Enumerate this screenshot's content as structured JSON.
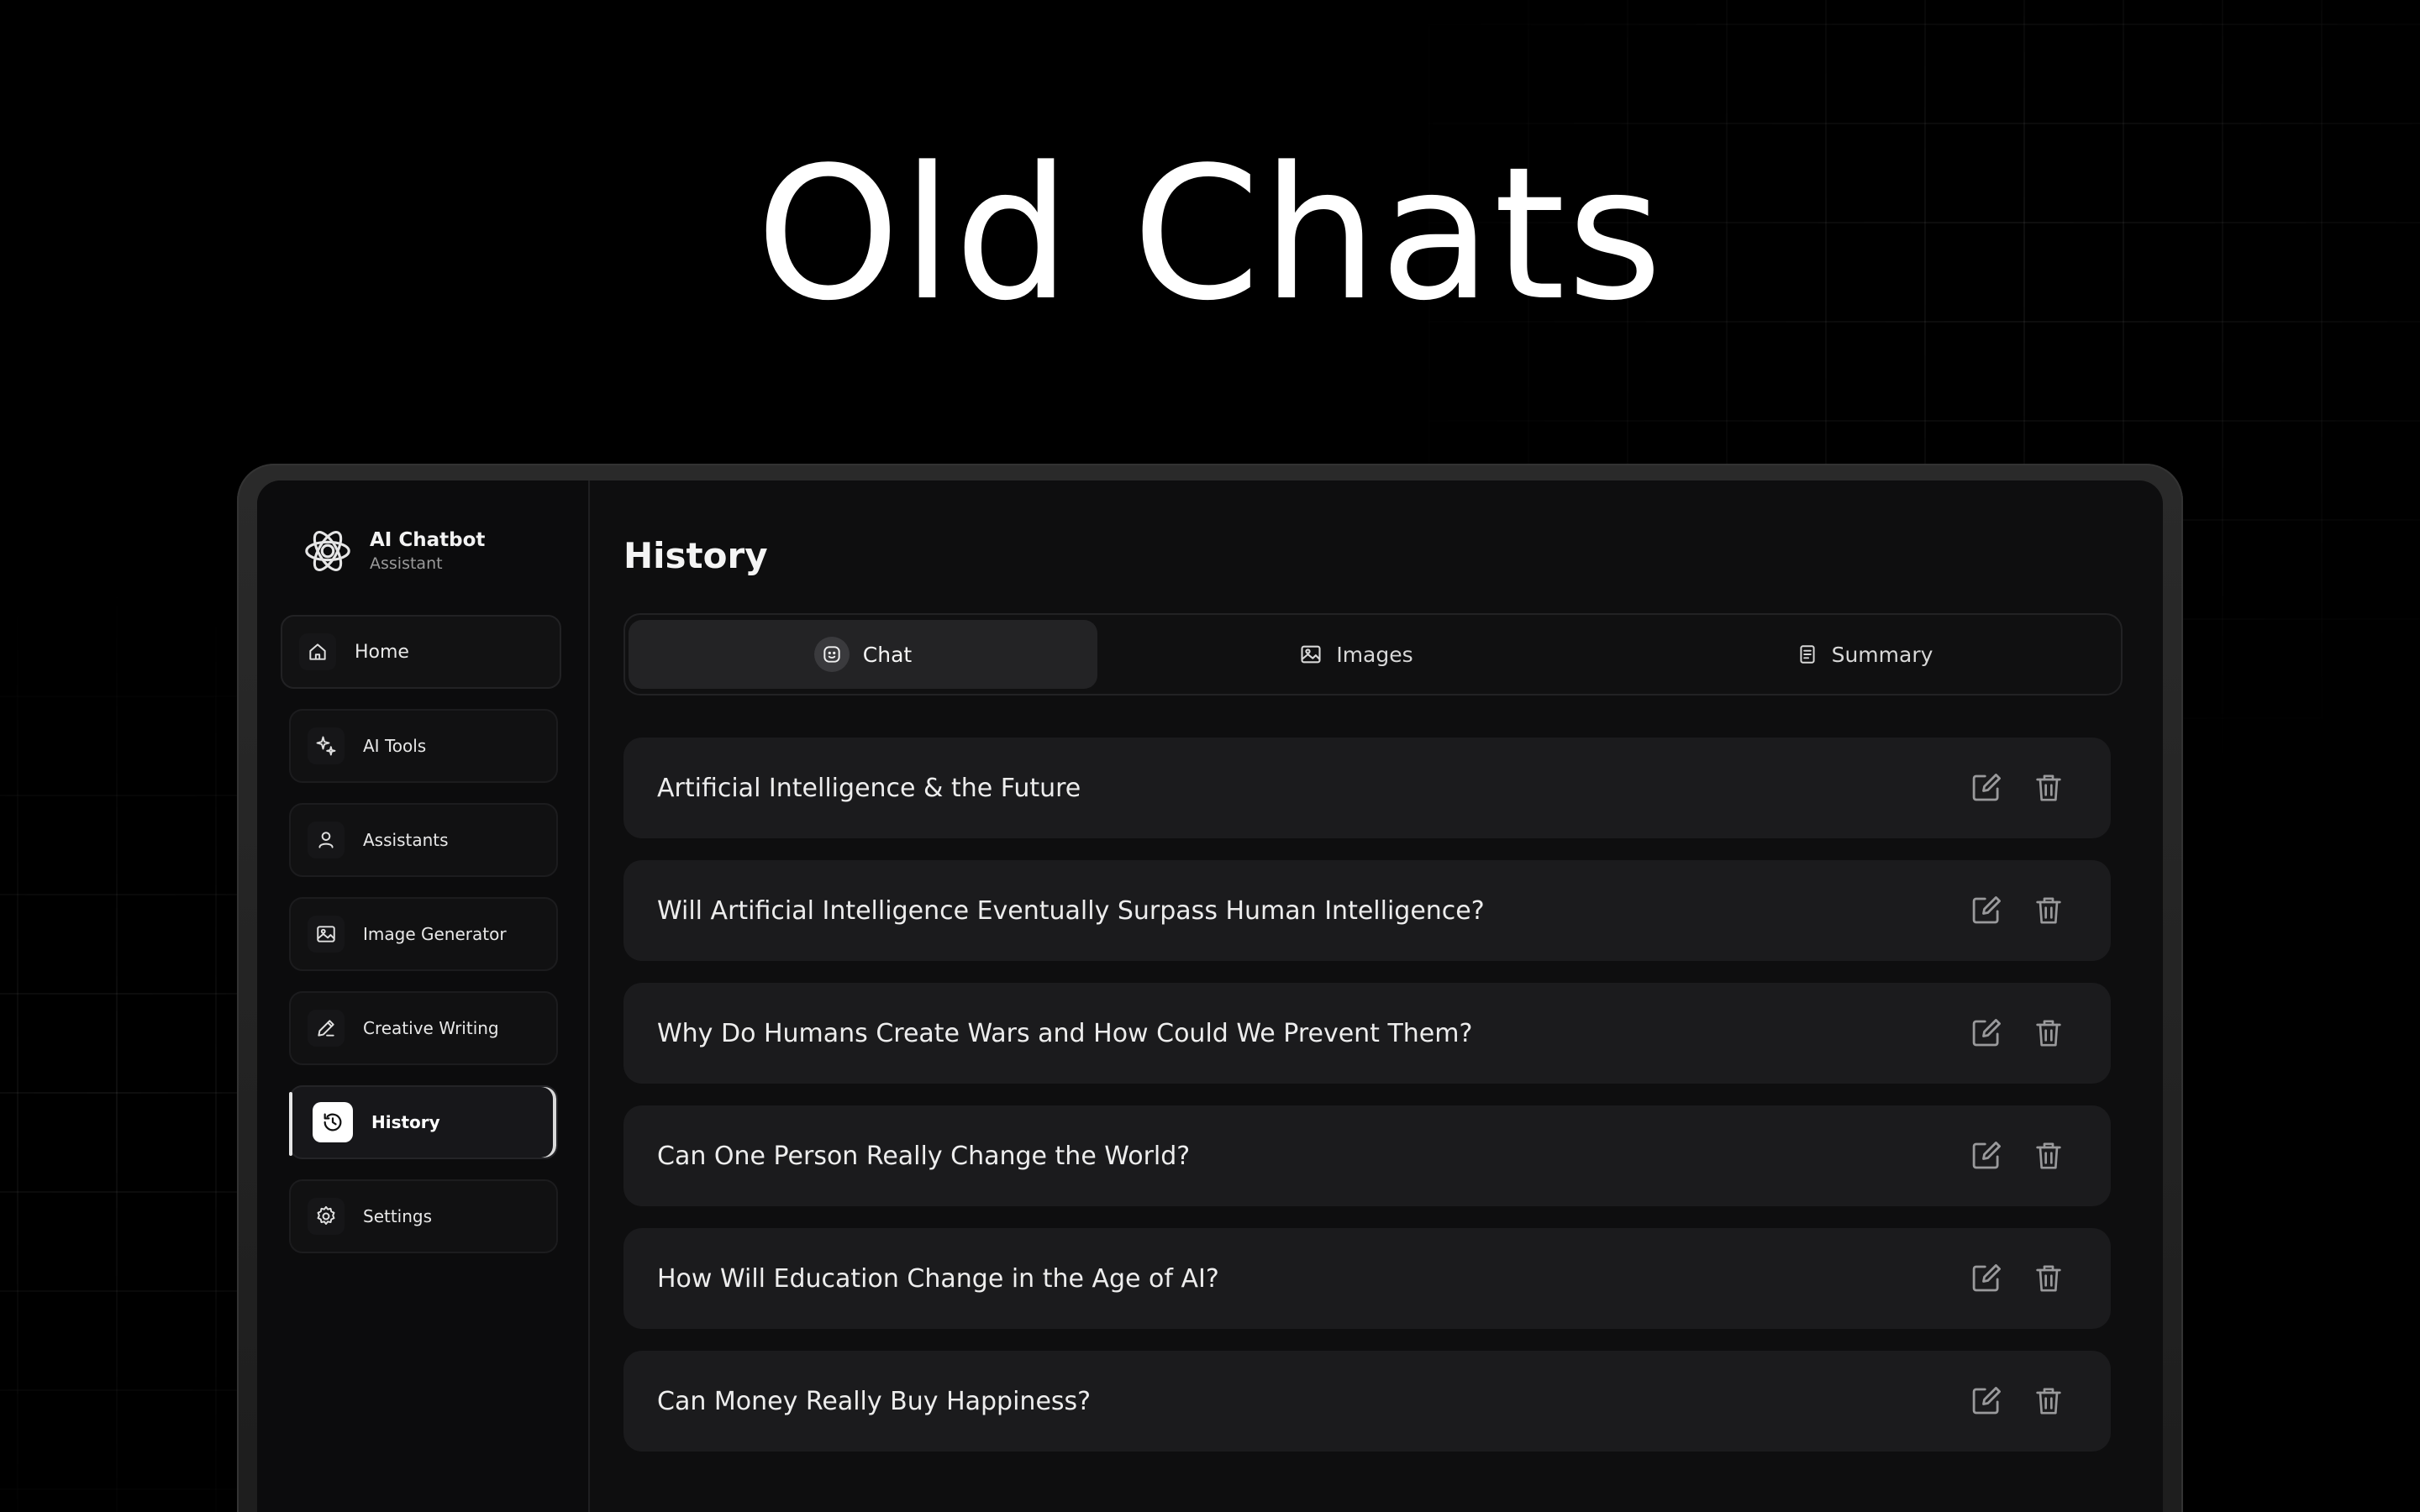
{
  "hero": {
    "title": "Old Chats"
  },
  "brand": {
    "title": "AI Chatbot",
    "subtitle": "Assistant",
    "logo_icon": "openai-knot-icon"
  },
  "sidebar": {
    "items": [
      {
        "label": "Home",
        "icon": "home-icon"
      },
      {
        "label": "AI Tools",
        "icon": "sparkles-icon"
      },
      {
        "label": "Assistants",
        "icon": "user-icon"
      },
      {
        "label": "Image Generator",
        "icon": "image-icon"
      },
      {
        "label": "Creative Writing",
        "icon": "pen-icon"
      },
      {
        "label": "History",
        "icon": "history-icon",
        "active": true
      },
      {
        "label": "Settings",
        "icon": "gear-icon"
      }
    ]
  },
  "main": {
    "title": "History",
    "tabs": [
      {
        "label": "Chat",
        "icon": "chat-face-icon",
        "active": true
      },
      {
        "label": "Images",
        "icon": "image-icon"
      },
      {
        "label": "Summary",
        "icon": "document-icon"
      }
    ],
    "chats": [
      {
        "title": "Artificial Intelligence & the Future"
      },
      {
        "title": "Will Artificial Intelligence Eventually Surpass Human Intelligence?"
      },
      {
        "title": "Why Do Humans Create Wars and How Could We Prevent Them?"
      },
      {
        "title": "Can One Person Really Change the World?"
      },
      {
        "title": "How Will Education Change in the Age of AI?"
      },
      {
        "title": "Can Money Really Buy Happiness?"
      }
    ],
    "row_actions": {
      "edit_icon": "edit-icon",
      "delete_icon": "trash-icon"
    }
  },
  "colors": {
    "background": "#000000",
    "screen": "#0e0e0f",
    "row": "#1b1b1d",
    "active_tab": "#232325",
    "text": "#ededed",
    "muted": "#9a9a9a"
  }
}
